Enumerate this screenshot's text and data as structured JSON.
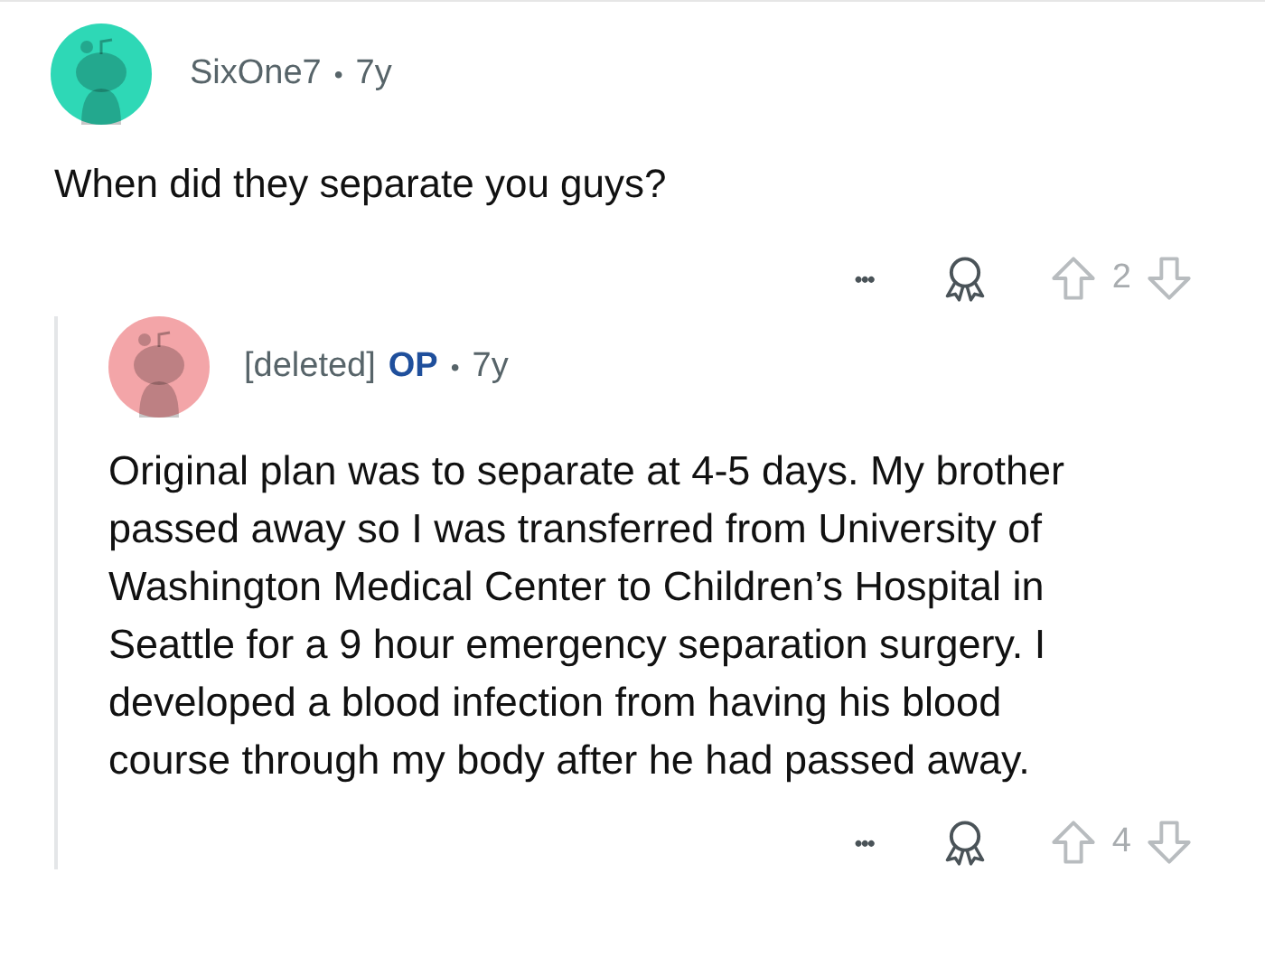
{
  "comment": {
    "author": "SixOne7",
    "separator": "•",
    "age": "7y",
    "body": "When did they separate you guys?",
    "actions": {
      "more": "•••",
      "score": "2"
    },
    "reply": {
      "author": "[deleted]",
      "badge": "OP",
      "separator": "•",
      "age": "7y",
      "body": "Original plan was to separate at 4-5 days. My brother passed away so I was transferred from University of Washington Medical Center to Children’s Hospital in Seattle for a 9 hour emergency separation surgery. I developed a blood infection from having his blood course through my body after he had passed away.",
      "actions": {
        "more": "•••",
        "score": "4"
      }
    }
  }
}
